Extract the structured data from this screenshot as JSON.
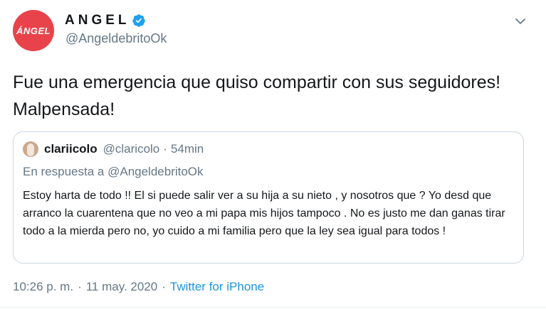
{
  "author": {
    "display_name": "ANGEL",
    "handle": "@AngeldebritoOk",
    "avatar_text": "ÁNGEL",
    "verified": true,
    "avatar_color": "#e8434a",
    "verified_color": "#1da1f2"
  },
  "tweet": {
    "text": "Fue una emergencia que quiso compartir con sus seguidores! Malpensada!",
    "time": "10:26 p. m.",
    "separator": "·",
    "date": "11 may. 2020",
    "source": "Twitter for iPhone"
  },
  "quoted_tweet": {
    "name": "clariicolo",
    "handle": "@claricolo",
    "separator": "·",
    "time": "54min",
    "reply_prefix": "En respuesta a",
    "reply_to": "@AngeldebritoOk",
    "text": "Estoy harta de todo !! El si puede salir ver a su hija a su nieto , y nosotros que ? Yo desd que arranco la cuarentena que no veo a mi papa mis hijos tampoco . No es justo me dan ganas tirar todo a la mierda pero no, yo cuido a mi familia pero que la ley sea igual para todos !"
  },
  "icons": {
    "menu": "chevron-down-icon",
    "verified": "verified-badge-icon"
  },
  "colors": {
    "link": "#1b95e0",
    "secondary_text": "#657786",
    "border": "#ccd6dd"
  }
}
